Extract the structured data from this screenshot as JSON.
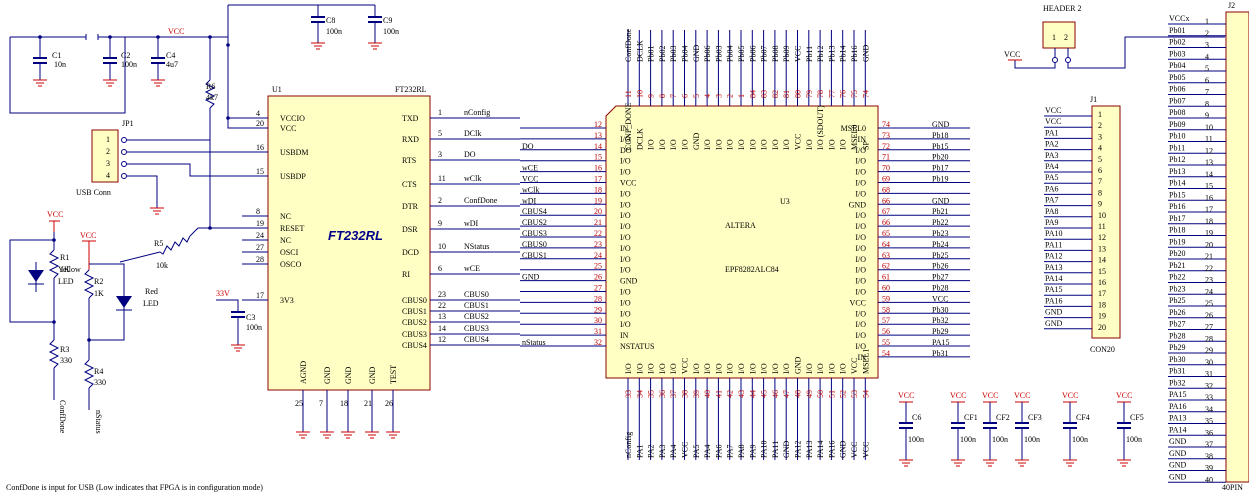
{
  "note": "ConfDone is input for USB (Low indicates that FPGA is in configuration mode)",
  "u1": {
    "ref": "U1",
    "part": "FT232RL",
    "name": "FT232RL",
    "left_pins": [
      {
        "num": "4",
        "name": "VCCIO"
      },
      {
        "num": "20",
        "name": "VCC"
      },
      {
        "num": "16",
        "name": "USBDM"
      },
      {
        "num": "15",
        "name": "USBDP"
      },
      {
        "num": "8",
        "name": "NC"
      },
      {
        "num": "19",
        "name": "RESET"
      },
      {
        "num": "24",
        "name": "NC"
      },
      {
        "num": "27",
        "name": "OSCI"
      },
      {
        "num": "28",
        "name": "OSCO"
      },
      {
        "num": "17",
        "name": "3V3"
      }
    ],
    "right_pins": [
      {
        "num": "1",
        "name": "TXD",
        "net": "nConfig"
      },
      {
        "num": "5",
        "name": "RXD",
        "net": "DClk"
      },
      {
        "num": "3",
        "name": "RTS",
        "net": "DO"
      },
      {
        "num": "11",
        "name": "CTS",
        "net": "wClk"
      },
      {
        "num": "2",
        "name": "DTR",
        "net": "ConfDone"
      },
      {
        "num": "9",
        "name": "DSR",
        "net": "wDI"
      },
      {
        "num": "10",
        "name": "DCD",
        "net": "NStatus"
      },
      {
        "num": "6",
        "name": "RI",
        "net": "wCE"
      },
      {
        "num": "23",
        "name": "CBUS0",
        "net": "CBUS0"
      },
      {
        "num": "22",
        "name": "CBUS1",
        "net": "CBUS1"
      },
      {
        "num": "13",
        "name": "CBUS2",
        "net": "CBUS2"
      },
      {
        "num": "14",
        "name": "CBUS3",
        "net": "CBUS3"
      },
      {
        "num": "12",
        "name": "CBUS4",
        "net": "CBUS4"
      }
    ],
    "bottom_pins": [
      {
        "num": "25",
        "name": "AGND"
      },
      {
        "num": "7",
        "name": "GND"
      },
      {
        "num": "18",
        "name": "GND"
      },
      {
        "num": "21",
        "name": "GND"
      },
      {
        "num": "26",
        "name": "TEST"
      }
    ]
  },
  "jp1": {
    "ref": "JP1",
    "label": "USB Conn",
    "pins": [
      "1",
      "2",
      "3",
      "4"
    ]
  },
  "caps_top": [
    {
      "ref": "C1",
      "value": "10n"
    },
    {
      "ref": "C2",
      "value": "100n"
    },
    {
      "ref": "C4",
      "value": "4u7"
    },
    {
      "ref": "C8",
      "value": "100n"
    },
    {
      "ref": "C9",
      "value": "100n"
    }
  ],
  "c3": {
    "ref": "C3",
    "value": "100n",
    "net": "33V"
  },
  "r6": {
    "ref": "R6",
    "value": "4k7"
  },
  "r5": {
    "ref": "R5",
    "value": "10k"
  },
  "r1": {
    "ref": "R1",
    "value": "1K"
  },
  "r2": {
    "ref": "R2",
    "value": "1K"
  },
  "r3": {
    "ref": "R3",
    "value": "330"
  },
  "r4": {
    "ref": "R4",
    "value": "330"
  },
  "led_yellow": {
    "label": "Yellow",
    "type": "LED"
  },
  "led_red": {
    "label": "Red",
    "type": "LED"
  },
  "vcc_label": "VCC",
  "gnd_label": "GND",
  "left_nets": {
    "confdone": "ConfDone",
    "nstatus": "nStatus"
  },
  "u3": {
    "ref": "U3",
    "vendor": "ALTERA",
    "part": "EPF8282ALC84",
    "top_pin_names": [
      "CONF_DONE",
      "DCLK",
      "I/O",
      "I/O",
      "I/O",
      "I/O",
      "GND",
      "I/O",
      "I/O",
      "I/O",
      "I/O",
      "I/O",
      "I/O",
      "I/O",
      "I/O",
      "VCC",
      "I/O",
      "I/O (SDOUT)",
      "I/O",
      "I/O",
      "MSEL0",
      "SP"
    ],
    "top_pin_nums": [
      "11",
      "10",
      "9",
      "8",
      "7",
      "6",
      "5",
      "4",
      "3",
      "2",
      "1",
      "84",
      "83",
      "82",
      "81",
      "80",
      "79",
      "78",
      "77",
      "76",
      "75",
      "74"
    ],
    "top_nets": [
      "ConfDone",
      "DCLK",
      "Pb01",
      "Pb02",
      "Pb03",
      "Pb04",
      "GND",
      "Pb06",
      "Pb03",
      "Pb04",
      "Pb05",
      "Pb06",
      "Pb07",
      "Pb08",
      "Pb09",
      "VCC",
      "Pb11",
      "Pb12",
      "Pb13",
      "Pb14",
      "Pb16",
      "GND"
    ],
    "left_pin_names": [
      "IN",
      "I/O",
      "DO",
      "I/O",
      "I/O",
      "VCC",
      "I/O",
      "I/O",
      "I/O",
      "I/O",
      "I/O",
      "I/O",
      "I/O",
      "I/O",
      "GND",
      "I/O",
      "I/O",
      "I/O",
      "I/O",
      "IN",
      "NSTATUS"
    ],
    "left_pin_nums": [
      "12",
      "13",
      "14",
      "15",
      "16",
      "17",
      "18",
      "19",
      "20",
      "21",
      "22",
      "23",
      "24",
      "25",
      "26",
      "27",
      "28",
      "29",
      "30",
      "31",
      "32"
    ],
    "left_nets": [
      "",
      "",
      "DO",
      "",
      "wCE",
      "VCC",
      "wClk",
      "wDI",
      "CBUS4",
      "CBUS2",
      "CBUS3",
      "CBUS0",
      "CBUS1",
      "",
      "GND",
      "",
      "",
      "",
      "",
      "",
      "nStatus"
    ],
    "bottom_pin_names": [
      "I/O",
      "I/O",
      "I/O",
      "I/O",
      "I/O",
      "VCC",
      "I/O",
      "I/O",
      "I/O",
      "I/O",
      "I/O",
      "I/O",
      "I/O",
      "I/O",
      "I/O",
      "GND",
      "I/O",
      "I/O",
      "I/O",
      "I/O",
      "VCC",
      "MSEL1"
    ],
    "bottom_pin_nums": [
      "33",
      "34",
      "35",
      "36",
      "37",
      "38",
      "39",
      "40",
      "41",
      "42",
      "43",
      "44",
      "45",
      "46",
      "47",
      "48",
      "49",
      "50",
      "51",
      "52",
      "53",
      "54"
    ],
    "bottom_nets": [
      "nConfig",
      "PA1",
      "PA2",
      "PA3",
      "PA4",
      "VCC",
      "PA5",
      "PA4",
      "PA6",
      "PA7",
      "PA8",
      "PA9",
      "PA10",
      "PA11",
      "GND",
      "PA12",
      "PA13",
      "PA14",
      "PA16",
      "GND",
      "VCC",
      "VCC"
    ],
    "right_pin_names": [
      "MSEL0",
      "IN",
      "I/O",
      "I/O",
      "I/O",
      "I/O",
      "I/O",
      "GND",
      "I/O",
      "I/O",
      "I/O",
      "I/O",
      "I/O",
      "I/O",
      "I/O",
      "I/O",
      "VCC",
      "I/O",
      "I/O",
      "I/O",
      "I/O",
      "IN"
    ],
    "right_pin_nums": [
      "74",
      "73",
      "72",
      "71",
      "70",
      "69",
      "68",
      "66",
      "67",
      "66",
      "65",
      "64",
      "63",
      "62",
      "61",
      "60",
      "59",
      "58",
      "57",
      "56",
      "55",
      "54"
    ],
    "right_nets": [
      "GND",
      "Pb18",
      "Pb15",
      "Pb20",
      "Pb17",
      "Pb19",
      "",
      "GND",
      "Pb21",
      "Pb22",
      "Pb23",
      "Pb24",
      "Pb25",
      "Pb26",
      "Pb27",
      "Pb28",
      "VCC",
      "Pb30",
      "Pb32",
      "Pb29",
      "PA15",
      "Pb31"
    ]
  },
  "header2": {
    "label": "HEADER 2",
    "pins": [
      "1",
      "2"
    ],
    "net": "VCC"
  },
  "j1": {
    "ref": "J1",
    "label": "CON20",
    "pins": [
      "1",
      "2",
      "3",
      "4",
      "5",
      "6",
      "7",
      "8",
      "9",
      "10",
      "11",
      "12",
      "13",
      "14",
      "15",
      "16",
      "17",
      "18",
      "19",
      "20"
    ],
    "nets": [
      "VCC",
      "VCC",
      "PA1",
      "PA2",
      "PA3",
      "PA4",
      "PA5",
      "PA6",
      "PA7",
      "PA8",
      "PA9",
      "PA10",
      "PA11",
      "PA12",
      "PA13",
      "PA14",
      "PA15",
      "PA16",
      "GND",
      "GND"
    ]
  },
  "j2": {
    "ref": "J2",
    "label": "40PIN",
    "pins": [
      "1",
      "2",
      "3",
      "4",
      "5",
      "6",
      "7",
      "8",
      "9",
      "10",
      "11",
      "12",
      "13",
      "14",
      "15",
      "16",
      "17",
      "18",
      "19",
      "20",
      "21",
      "22",
      "23",
      "24",
      "25",
      "26",
      "27",
      "28",
      "29",
      "30",
      "31",
      "32",
      "33",
      "34",
      "35",
      "36",
      "37",
      "38",
      "39",
      "40"
    ],
    "nets": [
      "VCCx",
      "Pb01",
      "Pb02",
      "Pb03",
      "Pb04",
      "Pb05",
      "Pb06",
      "Pb07",
      "Pb08",
      "Pb09",
      "Pb10",
      "Pb11",
      "Pb12",
      "Pb13",
      "Pb14",
      "Pb15",
      "Pb16",
      "Pb17",
      "Pb18",
      "Pb19",
      "Pb20",
      "Pb21",
      "Pb22",
      "Pb23",
      "Pb25",
      "Pb26",
      "Pb27",
      "Pb28",
      "Pb29",
      "Pb30",
      "Pb31",
      "Pb32",
      "PA15",
      "PA16",
      "PA13",
      "PA14",
      "GND",
      "GND",
      "GND",
      "GND"
    ]
  },
  "decoupling": [
    {
      "ref": "C6",
      "value": "100n"
    },
    {
      "ref": "CF1",
      "value": "100n"
    },
    {
      "ref": "CF2",
      "value": "100n"
    },
    {
      "ref": "CF3",
      "value": "100n"
    },
    {
      "ref": "CF4",
      "value": "100n"
    },
    {
      "ref": "CF5",
      "value": "100n"
    }
  ]
}
